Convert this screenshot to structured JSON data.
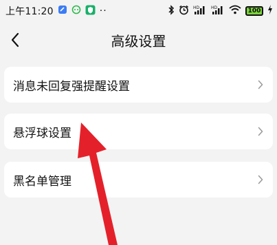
{
  "status_bar": {
    "time": "上午11:20",
    "notification_icons": [
      "note-icon",
      "chat-icon",
      "shield-app-icon"
    ],
    "dots": "··",
    "right_icons": [
      "bluetooth-icon",
      "alarm-icon",
      "hd-signal-icon",
      "hd-signal-icon",
      "wifi-icon"
    ],
    "battery": "100",
    "battery_color": "#7ad33a"
  },
  "header": {
    "title": "高级设置"
  },
  "settings": [
    {
      "label": "消息未回复强提醒设置"
    },
    {
      "label": "悬浮球设置"
    },
    {
      "label": "黑名单管理"
    }
  ],
  "annotation": {
    "type": "arrow",
    "color": "#e4212a",
    "points_to": "悬浮球设置"
  }
}
